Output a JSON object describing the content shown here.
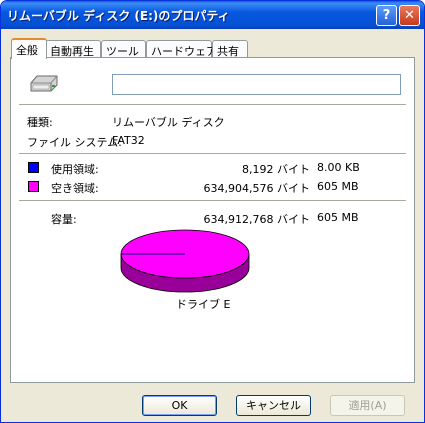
{
  "window": {
    "title": "リムーバブル ディスク (E:)のプロパティ",
    "help_glyph": "?",
    "close_glyph": "✕"
  },
  "tabs": [
    {
      "label": "全般",
      "active": true
    },
    {
      "label": "自動再生"
    },
    {
      "label": "ツール"
    },
    {
      "label": "ハードウェア"
    },
    {
      "label": "共有"
    }
  ],
  "general": {
    "icon": "removable-drive-icon",
    "label_value": "",
    "type_label": "種類:",
    "type_value": "リムーバブル ディスク",
    "fs_label": "ファイル システム:",
    "fs_value": "FAT32",
    "used": {
      "label": "使用領域:",
      "bytes": "8,192 バイト",
      "size": "8.00 KB",
      "color": "#0000ff"
    },
    "free": {
      "label": "空き領域:",
      "bytes": "634,904,576 バイト",
      "size": "605 MB",
      "color": "#ff00ff"
    },
    "capacity": {
      "label": "容量:",
      "bytes": "634,912,768 バイト",
      "size": "605 MB"
    },
    "used_fraction": 1.29e-05,
    "drive_label": "ドライブ E"
  },
  "buttons": {
    "ok": "OK",
    "cancel": "キャンセル",
    "apply": "適用(A)"
  }
}
